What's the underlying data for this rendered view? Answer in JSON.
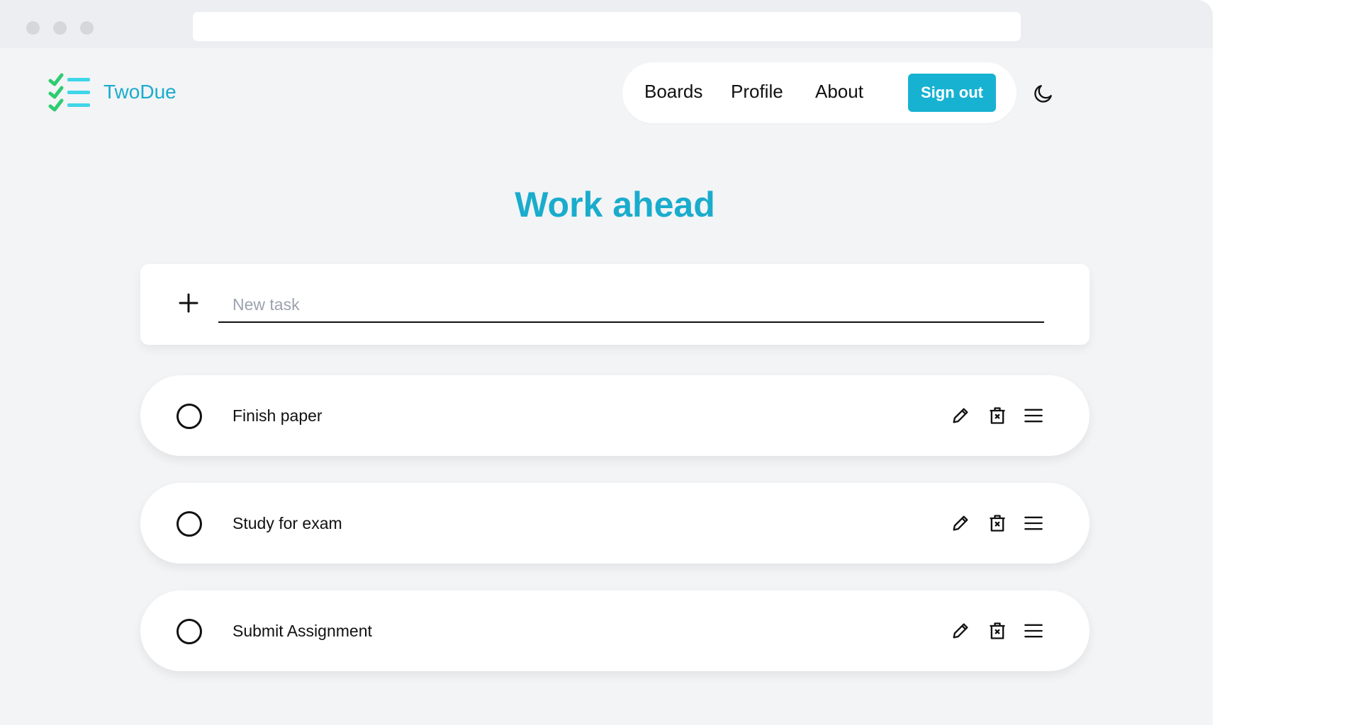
{
  "app": {
    "name": "TwoDue",
    "brand_color": "#1aaccc",
    "accent_color": "#17b2d2"
  },
  "nav": {
    "items": [
      "Boards",
      "Profile",
      "About"
    ],
    "sign_out_label": "Sign out",
    "theme_toggle_icon": "moon-icon"
  },
  "board": {
    "title": "Work ahead",
    "new_task": {
      "placeholder": "New task",
      "value": "",
      "add_icon": "plus-icon"
    },
    "tasks": [
      {
        "label": "Finish paper",
        "done": false
      },
      {
        "label": "Study for exam",
        "done": false
      },
      {
        "label": "Submit Assignment",
        "done": false
      }
    ],
    "task_action_icons": [
      "pencil-icon",
      "trash-icon",
      "drag-handle-icon"
    ]
  }
}
